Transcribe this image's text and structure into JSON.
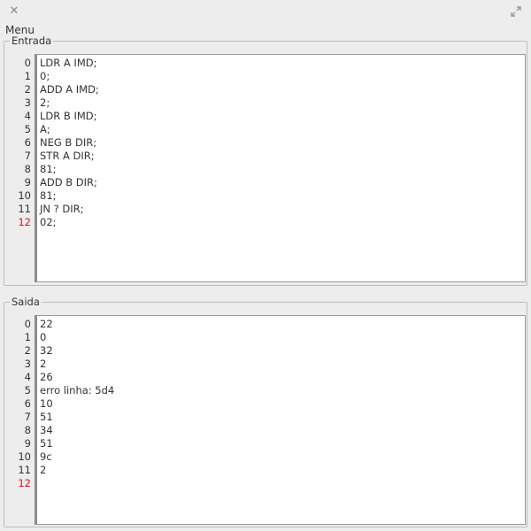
{
  "window": {
    "close_icon": "close-icon",
    "expand_icon": "expand-icon"
  },
  "menu": {
    "label": "Menu"
  },
  "entrada": {
    "title": "Entrada",
    "line_numbers": [
      "0",
      "1",
      "2",
      "3",
      "4",
      "5",
      "6",
      "7",
      "8",
      "9",
      "10",
      "11",
      "12"
    ],
    "current_line": "12",
    "lines": [
      "LDR A IMD;",
      "0;",
      "ADD A IMD;",
      "2;",
      "LDR B IMD;",
      "A;",
      "NEG B DIR;",
      "STR A DIR;",
      "81;",
      "ADD B DIR;",
      "81;",
      "JN ? DIR;",
      "02;"
    ]
  },
  "saida": {
    "title": "Saida",
    "line_numbers": [
      "0",
      "1",
      "2",
      "3",
      "4",
      "5",
      "6",
      "7",
      "8",
      "9",
      "10",
      "11",
      "12"
    ],
    "current_line": "12",
    "lines": [
      "22",
      "0",
      "32",
      "2",
      "26",
      "erro linha: 5d4",
      "10",
      "51",
      "34",
      "51",
      "9c",
      "2",
      ""
    ]
  },
  "colors": {
    "current_line_number": "#d01919",
    "background": "#ededed",
    "editor_background": "#ffffff"
  }
}
